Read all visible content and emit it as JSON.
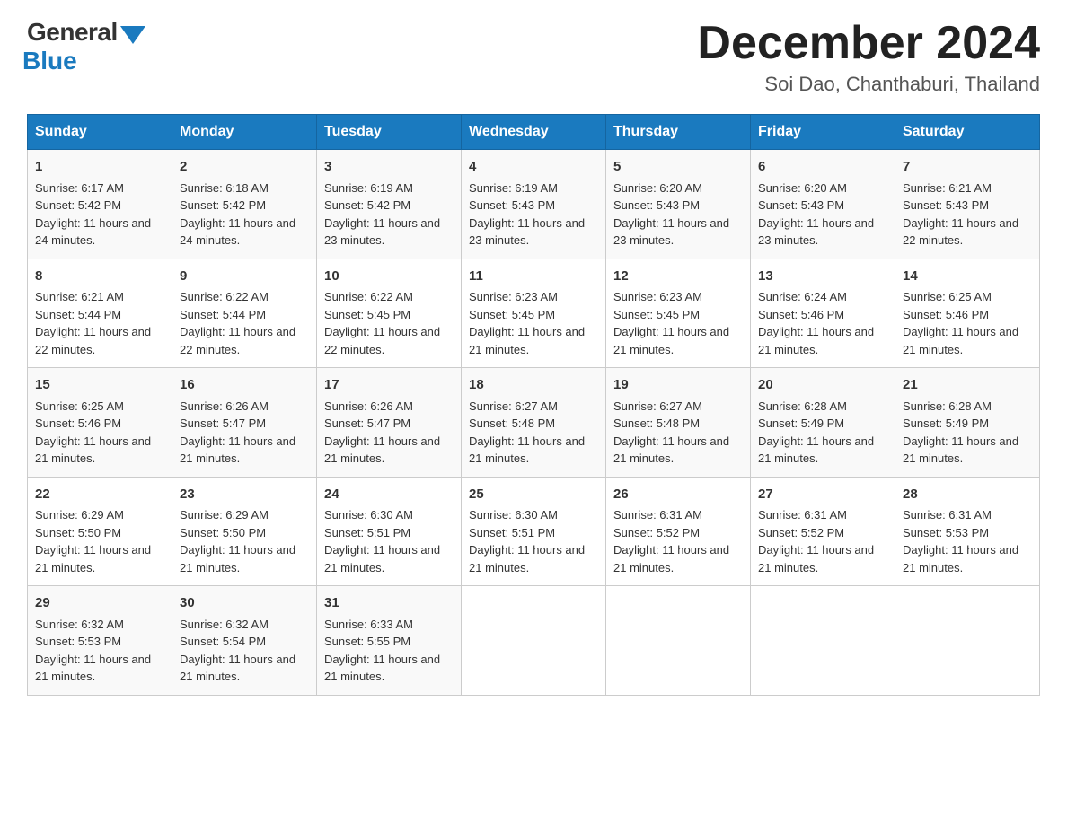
{
  "logo": {
    "general": "General",
    "blue": "Blue"
  },
  "title": "December 2024",
  "location": "Soi Dao, Chanthaburi, Thailand",
  "days_of_week": [
    "Sunday",
    "Monday",
    "Tuesday",
    "Wednesday",
    "Thursday",
    "Friday",
    "Saturday"
  ],
  "weeks": [
    [
      {
        "day": "1",
        "sunrise": "6:17 AM",
        "sunset": "5:42 PM",
        "daylight": "11 hours and 24 minutes."
      },
      {
        "day": "2",
        "sunrise": "6:18 AM",
        "sunset": "5:42 PM",
        "daylight": "11 hours and 24 minutes."
      },
      {
        "day": "3",
        "sunrise": "6:19 AM",
        "sunset": "5:42 PM",
        "daylight": "11 hours and 23 minutes."
      },
      {
        "day": "4",
        "sunrise": "6:19 AM",
        "sunset": "5:43 PM",
        "daylight": "11 hours and 23 minutes."
      },
      {
        "day": "5",
        "sunrise": "6:20 AM",
        "sunset": "5:43 PM",
        "daylight": "11 hours and 23 minutes."
      },
      {
        "day": "6",
        "sunrise": "6:20 AM",
        "sunset": "5:43 PM",
        "daylight": "11 hours and 23 minutes."
      },
      {
        "day": "7",
        "sunrise": "6:21 AM",
        "sunset": "5:43 PM",
        "daylight": "11 hours and 22 minutes."
      }
    ],
    [
      {
        "day": "8",
        "sunrise": "6:21 AM",
        "sunset": "5:44 PM",
        "daylight": "11 hours and 22 minutes."
      },
      {
        "day": "9",
        "sunrise": "6:22 AM",
        "sunset": "5:44 PM",
        "daylight": "11 hours and 22 minutes."
      },
      {
        "day": "10",
        "sunrise": "6:22 AM",
        "sunset": "5:45 PM",
        "daylight": "11 hours and 22 minutes."
      },
      {
        "day": "11",
        "sunrise": "6:23 AM",
        "sunset": "5:45 PM",
        "daylight": "11 hours and 21 minutes."
      },
      {
        "day": "12",
        "sunrise": "6:23 AM",
        "sunset": "5:45 PM",
        "daylight": "11 hours and 21 minutes."
      },
      {
        "day": "13",
        "sunrise": "6:24 AM",
        "sunset": "5:46 PM",
        "daylight": "11 hours and 21 minutes."
      },
      {
        "day": "14",
        "sunrise": "6:25 AM",
        "sunset": "5:46 PM",
        "daylight": "11 hours and 21 minutes."
      }
    ],
    [
      {
        "day": "15",
        "sunrise": "6:25 AM",
        "sunset": "5:46 PM",
        "daylight": "11 hours and 21 minutes."
      },
      {
        "day": "16",
        "sunrise": "6:26 AM",
        "sunset": "5:47 PM",
        "daylight": "11 hours and 21 minutes."
      },
      {
        "day": "17",
        "sunrise": "6:26 AM",
        "sunset": "5:47 PM",
        "daylight": "11 hours and 21 minutes."
      },
      {
        "day": "18",
        "sunrise": "6:27 AM",
        "sunset": "5:48 PM",
        "daylight": "11 hours and 21 minutes."
      },
      {
        "day": "19",
        "sunrise": "6:27 AM",
        "sunset": "5:48 PM",
        "daylight": "11 hours and 21 minutes."
      },
      {
        "day": "20",
        "sunrise": "6:28 AM",
        "sunset": "5:49 PM",
        "daylight": "11 hours and 21 minutes."
      },
      {
        "day": "21",
        "sunrise": "6:28 AM",
        "sunset": "5:49 PM",
        "daylight": "11 hours and 21 minutes."
      }
    ],
    [
      {
        "day": "22",
        "sunrise": "6:29 AM",
        "sunset": "5:50 PM",
        "daylight": "11 hours and 21 minutes."
      },
      {
        "day": "23",
        "sunrise": "6:29 AM",
        "sunset": "5:50 PM",
        "daylight": "11 hours and 21 minutes."
      },
      {
        "day": "24",
        "sunrise": "6:30 AM",
        "sunset": "5:51 PM",
        "daylight": "11 hours and 21 minutes."
      },
      {
        "day": "25",
        "sunrise": "6:30 AM",
        "sunset": "5:51 PM",
        "daylight": "11 hours and 21 minutes."
      },
      {
        "day": "26",
        "sunrise": "6:31 AM",
        "sunset": "5:52 PM",
        "daylight": "11 hours and 21 minutes."
      },
      {
        "day": "27",
        "sunrise": "6:31 AM",
        "sunset": "5:52 PM",
        "daylight": "11 hours and 21 minutes."
      },
      {
        "day": "28",
        "sunrise": "6:31 AM",
        "sunset": "5:53 PM",
        "daylight": "11 hours and 21 minutes."
      }
    ],
    [
      {
        "day": "29",
        "sunrise": "6:32 AM",
        "sunset": "5:53 PM",
        "daylight": "11 hours and 21 minutes."
      },
      {
        "day": "30",
        "sunrise": "6:32 AM",
        "sunset": "5:54 PM",
        "daylight": "11 hours and 21 minutes."
      },
      {
        "day": "31",
        "sunrise": "6:33 AM",
        "sunset": "5:55 PM",
        "daylight": "11 hours and 21 minutes."
      },
      null,
      null,
      null,
      null
    ]
  ],
  "labels": {
    "sunrise_prefix": "Sunrise: ",
    "sunset_prefix": "Sunset: ",
    "daylight_prefix": "Daylight: "
  }
}
